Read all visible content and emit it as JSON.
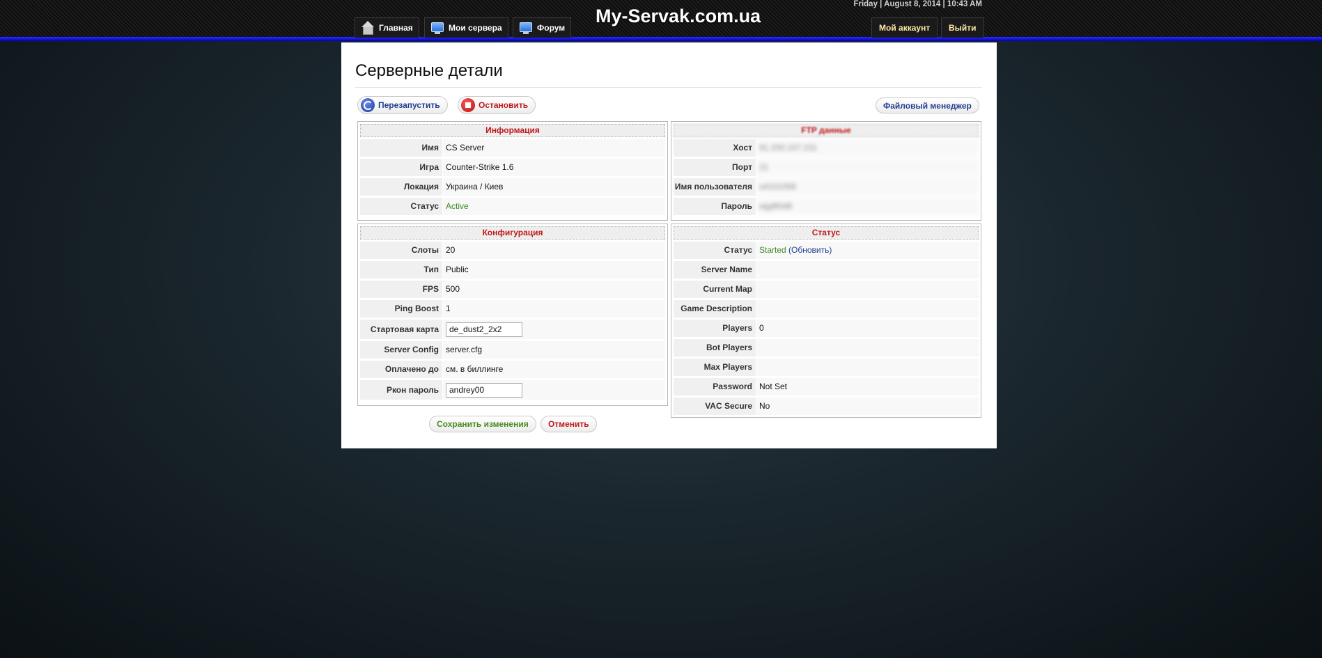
{
  "header": {
    "site_title": "My-Servak.com.ua",
    "datetime": "Friday | August 8, 2014 | 10:43 AM",
    "nav": [
      {
        "label": "Главная",
        "icon": "house-icon"
      },
      {
        "label": "Мои сервера",
        "icon": "monitor-icon"
      },
      {
        "label": "Форум",
        "icon": "monitor-icon"
      }
    ],
    "account_label": "Мой аккаунт",
    "logout_label": "Выйти"
  },
  "page": {
    "title": "Серверные детали",
    "restart_label": "Перезапустить",
    "stop_label": "Остановить",
    "file_manager_label": "Файловый менеджер"
  },
  "info": {
    "heading": "Информация",
    "rows": [
      {
        "label": "Имя",
        "value": "CS Server"
      },
      {
        "label": "Игра",
        "value": "Counter-Strike 1.6"
      },
      {
        "label": "Локация",
        "value": "Украина / Киев"
      },
      {
        "label": "Статус",
        "value": "Active"
      }
    ]
  },
  "ftp": {
    "heading": "FTP данные",
    "rows": [
      {
        "label": "Хост",
        "value": "91.200.107.231"
      },
      {
        "label": "Порт",
        "value": "21"
      },
      {
        "label": "Имя пользователя",
        "value": "s4101058"
      },
      {
        "label": "Пароль",
        "value": "wjg8l0d6"
      }
    ]
  },
  "config": {
    "heading": "Конфигурация",
    "slots": {
      "label": "Слоты",
      "value": "20"
    },
    "type": {
      "label": "Тип",
      "value": "Public"
    },
    "fps": {
      "label": "FPS",
      "value": "500"
    },
    "ping_boost": {
      "label": "Ping Boost",
      "value": "1"
    },
    "start_map": {
      "label": "Стартовая карта",
      "value": "de_dust2_2x2"
    },
    "server_config": {
      "label": "Server Config",
      "value": "server.cfg"
    },
    "paid_until": {
      "label": "Оплачено до",
      "value": "см. в биллинге"
    },
    "rcon": {
      "label": "Ркон пароль",
      "value": "andrey00"
    }
  },
  "status": {
    "heading": "Статус",
    "state": {
      "label": "Статус",
      "value": "Started",
      "refresh": "(Обновить)"
    },
    "rows": [
      {
        "label": "Server Name",
        "value": ""
      },
      {
        "label": "Current Map",
        "value": ""
      },
      {
        "label": "Game Description",
        "value": ""
      },
      {
        "label": "Players",
        "value": "0"
      },
      {
        "label": "Bot Players",
        "value": ""
      },
      {
        "label": "Max Players",
        "value": ""
      },
      {
        "label": "Password",
        "value": "Not Set"
      },
      {
        "label": "VAC Secure",
        "value": "No"
      }
    ]
  },
  "actions": {
    "save_label": "Сохранить изменения",
    "cancel_label": "Отменить"
  }
}
